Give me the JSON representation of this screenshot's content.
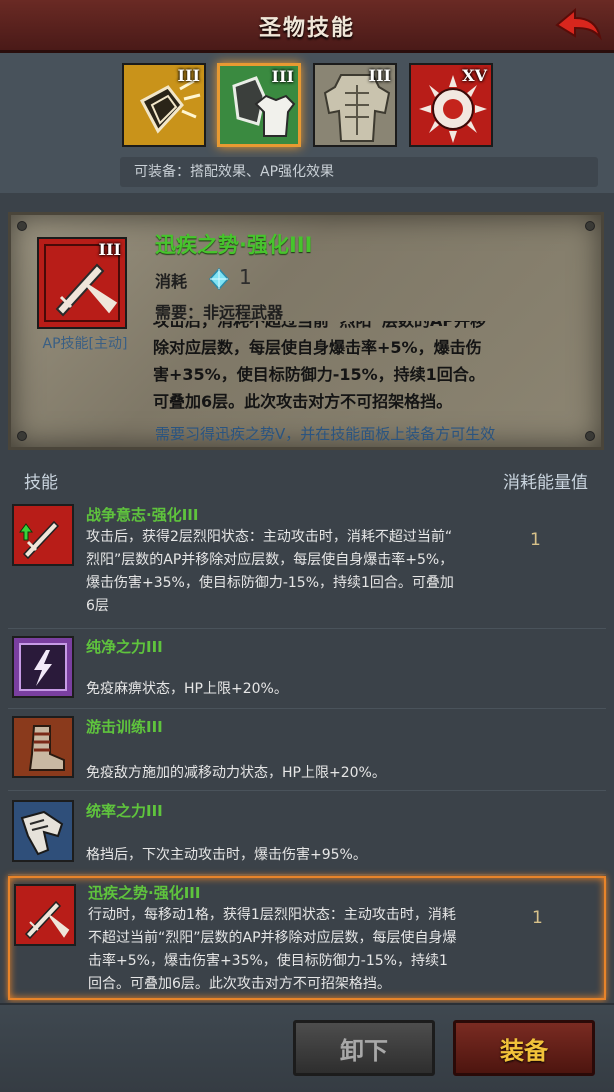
{
  "header": {
    "title": "圣物技能"
  },
  "relics": [
    {
      "level": "III",
      "icon": "broken-shield-icon",
      "bg": "#d9a522"
    },
    {
      "level": "III",
      "icon": "shield-shirt-icon",
      "bg": "#3e8a43",
      "selected": true
    },
    {
      "level": "III",
      "icon": "armor-icon",
      "bg": "#8f8a78"
    },
    {
      "level": "XV",
      "icon": "sun-emblem-icon",
      "bg": "#b31e1a"
    }
  ],
  "equip_hint": "可装备：搭配效果、AP强化效果",
  "detail": {
    "name": "迅疾之势·强化III",
    "level": "III",
    "type": "AP技能[主动]",
    "cost_label": "消耗",
    "cost_value": "1",
    "requirement": "需要：非远程武器",
    "description_partial": "攻击后，消耗不超过当前“烈阳”层数的AP并移",
    "description": "除对应层数，每层使自身爆击率+5%，爆击伤\n害+35%，使目标防御力-15%，持续1回合。\n可叠加6层。此次攻击对方不可招架格挡。",
    "prereq": "需要习得迅疾之势V，并在技能面板上装备方可生效"
  },
  "list_header": {
    "skill": "技能",
    "cost": "消耗能量值"
  },
  "skills": [
    {
      "name": "战争意志·强化III",
      "icon": "sword-arrow-icon",
      "desc": "攻击后，获得2层烈阳状态：主动攻击时，消耗不超过当前“\n烈阳”层数的AP并移除对应层数，每层使自身爆击率+5%，\n爆击伤害+35%，使目标防御力-15%，持续1回合。可叠加\n6层",
      "cost": "1"
    },
    {
      "name": "纯净之力III",
      "icon": "lightning-icon",
      "desc": "免疫麻痹状态，HP上限+20%。",
      "cost": ""
    },
    {
      "name": "游击训练III",
      "icon": "boot-icon",
      "desc": "免疫敌方施加的减移动力状态，HP上限+20%。",
      "cost": ""
    },
    {
      "name": "统率之力III",
      "icon": "gauntlet-icon",
      "desc": "格挡后，下次主动攻击时，爆击伤害+95%。",
      "cost": ""
    },
    {
      "name": "迅疾之势·强化III",
      "icon": "sword-rush-icon",
      "desc": "行动时，每移动1格，获得1层烈阳状态：主动攻击时，消耗\n不超过当前“烈阳”层数的AP并移除对应层数，每层使自身爆\n击率+5%，爆击伤害+35%，使目标防御力-15%，持续1\n回合。可叠加6层。此次攻击对方不可招架格挡。",
      "cost": "1",
      "selected": true
    }
  ],
  "buttons": {
    "unequip": "卸下",
    "equip": "装备"
  }
}
